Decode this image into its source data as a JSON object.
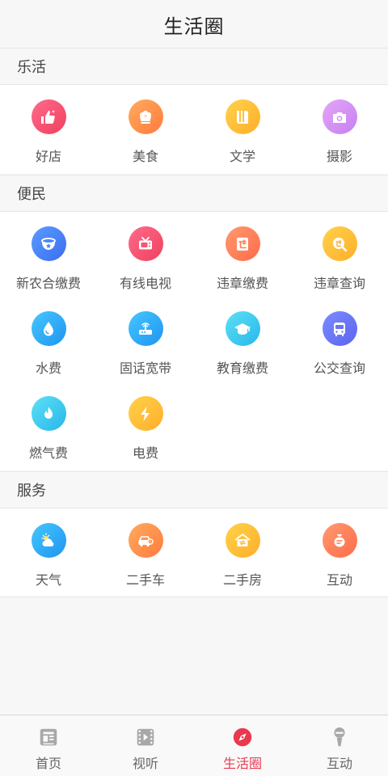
{
  "header": {
    "title": "生活圈"
  },
  "sections": [
    {
      "title": "乐活",
      "items": [
        {
          "label": "好店",
          "icon": "thumbs-up-icon",
          "color": "#f0405f"
        },
        {
          "label": "美食",
          "icon": "food-icon",
          "color": "#ff7b3d"
        },
        {
          "label": "文学",
          "icon": "book-icon",
          "color": "#ffae2a"
        },
        {
          "label": "摄影",
          "icon": "camera-icon",
          "color": "#c67ff2"
        }
      ]
    },
    {
      "title": "便民",
      "items": [
        {
          "label": "新农合缴费",
          "icon": "bowl-icon",
          "color": "#3b6ef0"
        },
        {
          "label": "有线电视",
          "icon": "tv-icon",
          "color": "#f0405f"
        },
        {
          "label": "违章缴费",
          "icon": "violation-icon",
          "color": "#ff7b3d"
        },
        {
          "label": "违章查询",
          "icon": "violation-search-icon",
          "color": "#ffae2a"
        },
        {
          "label": "水费",
          "icon": "water-drop-icon",
          "color": "#1f95f0"
        },
        {
          "label": "固话宽带",
          "icon": "router-icon",
          "color": "#1f95f0"
        },
        {
          "label": "教育缴费",
          "icon": "graduation-cap-icon",
          "color": "#26b7ea"
        },
        {
          "label": "公交查询",
          "icon": "bus-icon",
          "color": "#5b63ef"
        },
        {
          "label": "燃气费",
          "icon": "flame-icon",
          "color": "#26b7ea"
        },
        {
          "label": "电费",
          "icon": "lightning-icon",
          "color": "#ffae2a"
        }
      ]
    },
    {
      "title": "服务",
      "items": [
        {
          "label": "天气",
          "icon": "weather-icon",
          "color": "#1f95f0"
        },
        {
          "label": "二手车",
          "icon": "car-icon",
          "color": "#ff7b3d"
        },
        {
          "label": "二手房",
          "icon": "house-icon",
          "color": "#ffae2a"
        },
        {
          "label": "互动",
          "icon": "chat-icon",
          "color": "#ff6b4a"
        }
      ]
    }
  ],
  "tabbar": {
    "active_color": "#e8394e",
    "items": [
      {
        "label": "首页",
        "icon": "news-icon"
      },
      {
        "label": "视听",
        "icon": "video-icon"
      },
      {
        "label": "生活圈",
        "icon": "compass-icon",
        "active": true
      },
      {
        "label": "互动",
        "icon": "microphone-icon"
      }
    ]
  }
}
